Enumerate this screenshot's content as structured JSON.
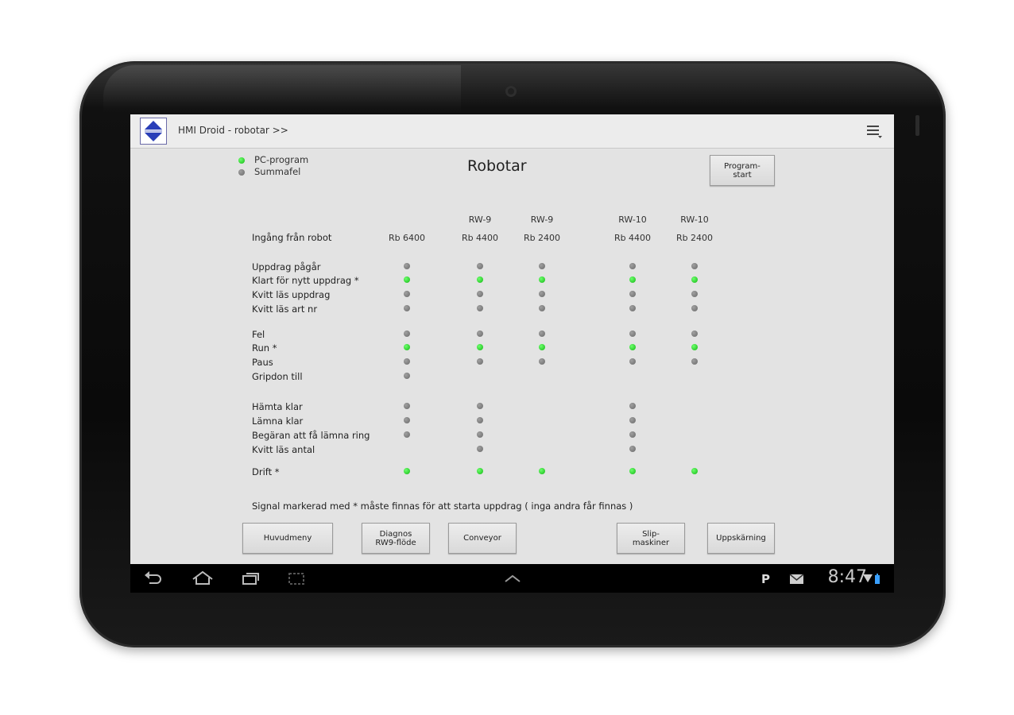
{
  "app": {
    "title": "HMI Droid - robotar >>"
  },
  "legend": [
    {
      "label": "PC-program",
      "state": "green"
    },
    {
      "label": "Summafel",
      "state": "grey"
    }
  ],
  "page_title": "Robotar",
  "buttons": {
    "programstart": "Program-\nstart",
    "huvudmeny": "Huvudmeny",
    "diagnos": "Diagnos\nRW9-flöde",
    "conveyor": "Conveyor",
    "slipmaskiner": "Slip-\nmaskiner",
    "uppskarning": "Uppskärning"
  },
  "table": {
    "header_label": "Ingång från robot",
    "columns": [
      {
        "group": "",
        "name": "Rb 6400"
      },
      {
        "group": "RW-9",
        "name": "Rb 4400"
      },
      {
        "group": "RW-9",
        "name": "Rb 2400"
      },
      {
        "group": "RW-10",
        "name": "Rb 4400"
      },
      {
        "group": "RW-10",
        "name": "Rb 2400"
      }
    ],
    "rows": [
      {
        "label": "Uppdrag pågår",
        "signals": [
          "grey",
          "grey",
          "grey",
          "grey",
          "grey"
        ]
      },
      {
        "label": "Klart för nytt uppdrag *",
        "signals": [
          "green",
          "green",
          "green",
          "green",
          "green"
        ]
      },
      {
        "label": "Kvitt läs uppdrag",
        "signals": [
          "grey",
          "grey",
          "grey",
          "grey",
          "grey"
        ]
      },
      {
        "label": "Kvitt läs art nr",
        "signals": [
          "grey",
          "grey",
          "grey",
          "grey",
          "grey"
        ]
      },
      {
        "label": "Fel",
        "signals": [
          "grey",
          "grey",
          "grey",
          "grey",
          "grey"
        ]
      },
      {
        "label": "Run *",
        "signals": [
          "green",
          "green",
          "green",
          "green",
          "green"
        ]
      },
      {
        "label": "Paus",
        "signals": [
          "grey",
          "grey",
          "grey",
          "grey",
          "grey"
        ]
      },
      {
        "label": "Gripdon till",
        "signals": [
          "grey",
          null,
          null,
          null,
          null
        ]
      },
      {
        "label": "Hämta klar",
        "signals": [
          "grey",
          "grey",
          null,
          "grey",
          null
        ]
      },
      {
        "label": "Lämna klar",
        "signals": [
          "grey",
          "grey",
          null,
          "grey",
          null
        ]
      },
      {
        "label": "Begäran att få lämna ring",
        "signals": [
          "grey",
          "grey",
          null,
          "grey",
          null
        ]
      },
      {
        "label": "Kvitt läs antal",
        "signals": [
          null,
          "grey",
          null,
          "grey",
          null
        ]
      },
      {
        "label": "Drift *",
        "signals": [
          "green",
          "green",
          "green",
          "green",
          "green"
        ]
      }
    ]
  },
  "footnote": "Signal markerad med * måste finnas för att starta uppdrag ( inga andra får finnas )",
  "statusbar": {
    "time": "8:47"
  },
  "colors": {
    "active": "#22cc22",
    "inactive": "#808080",
    "screen_bg": "#e3e3e3"
  }
}
